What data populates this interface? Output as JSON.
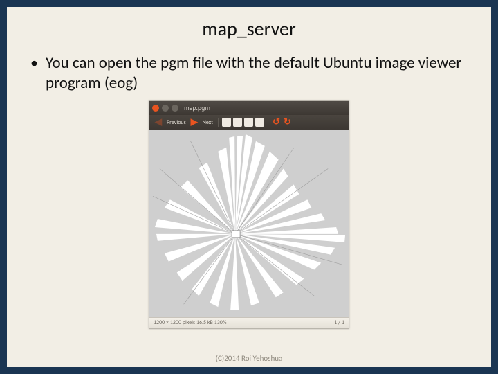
{
  "slide": {
    "title": "map_server",
    "bullet": "You can open the pgm file with the default Ubuntu image viewer program (eog)",
    "footer": "(C)2014 Roi Yehoshua"
  },
  "viewer": {
    "window_title": "map.pgm",
    "toolbar": {
      "prev_label": "Previous",
      "next_label": "Next"
    },
    "statusbar": {
      "left": "1200 × 1200 pixels  16.5 kB   130%",
      "right": "1 / 1"
    }
  }
}
